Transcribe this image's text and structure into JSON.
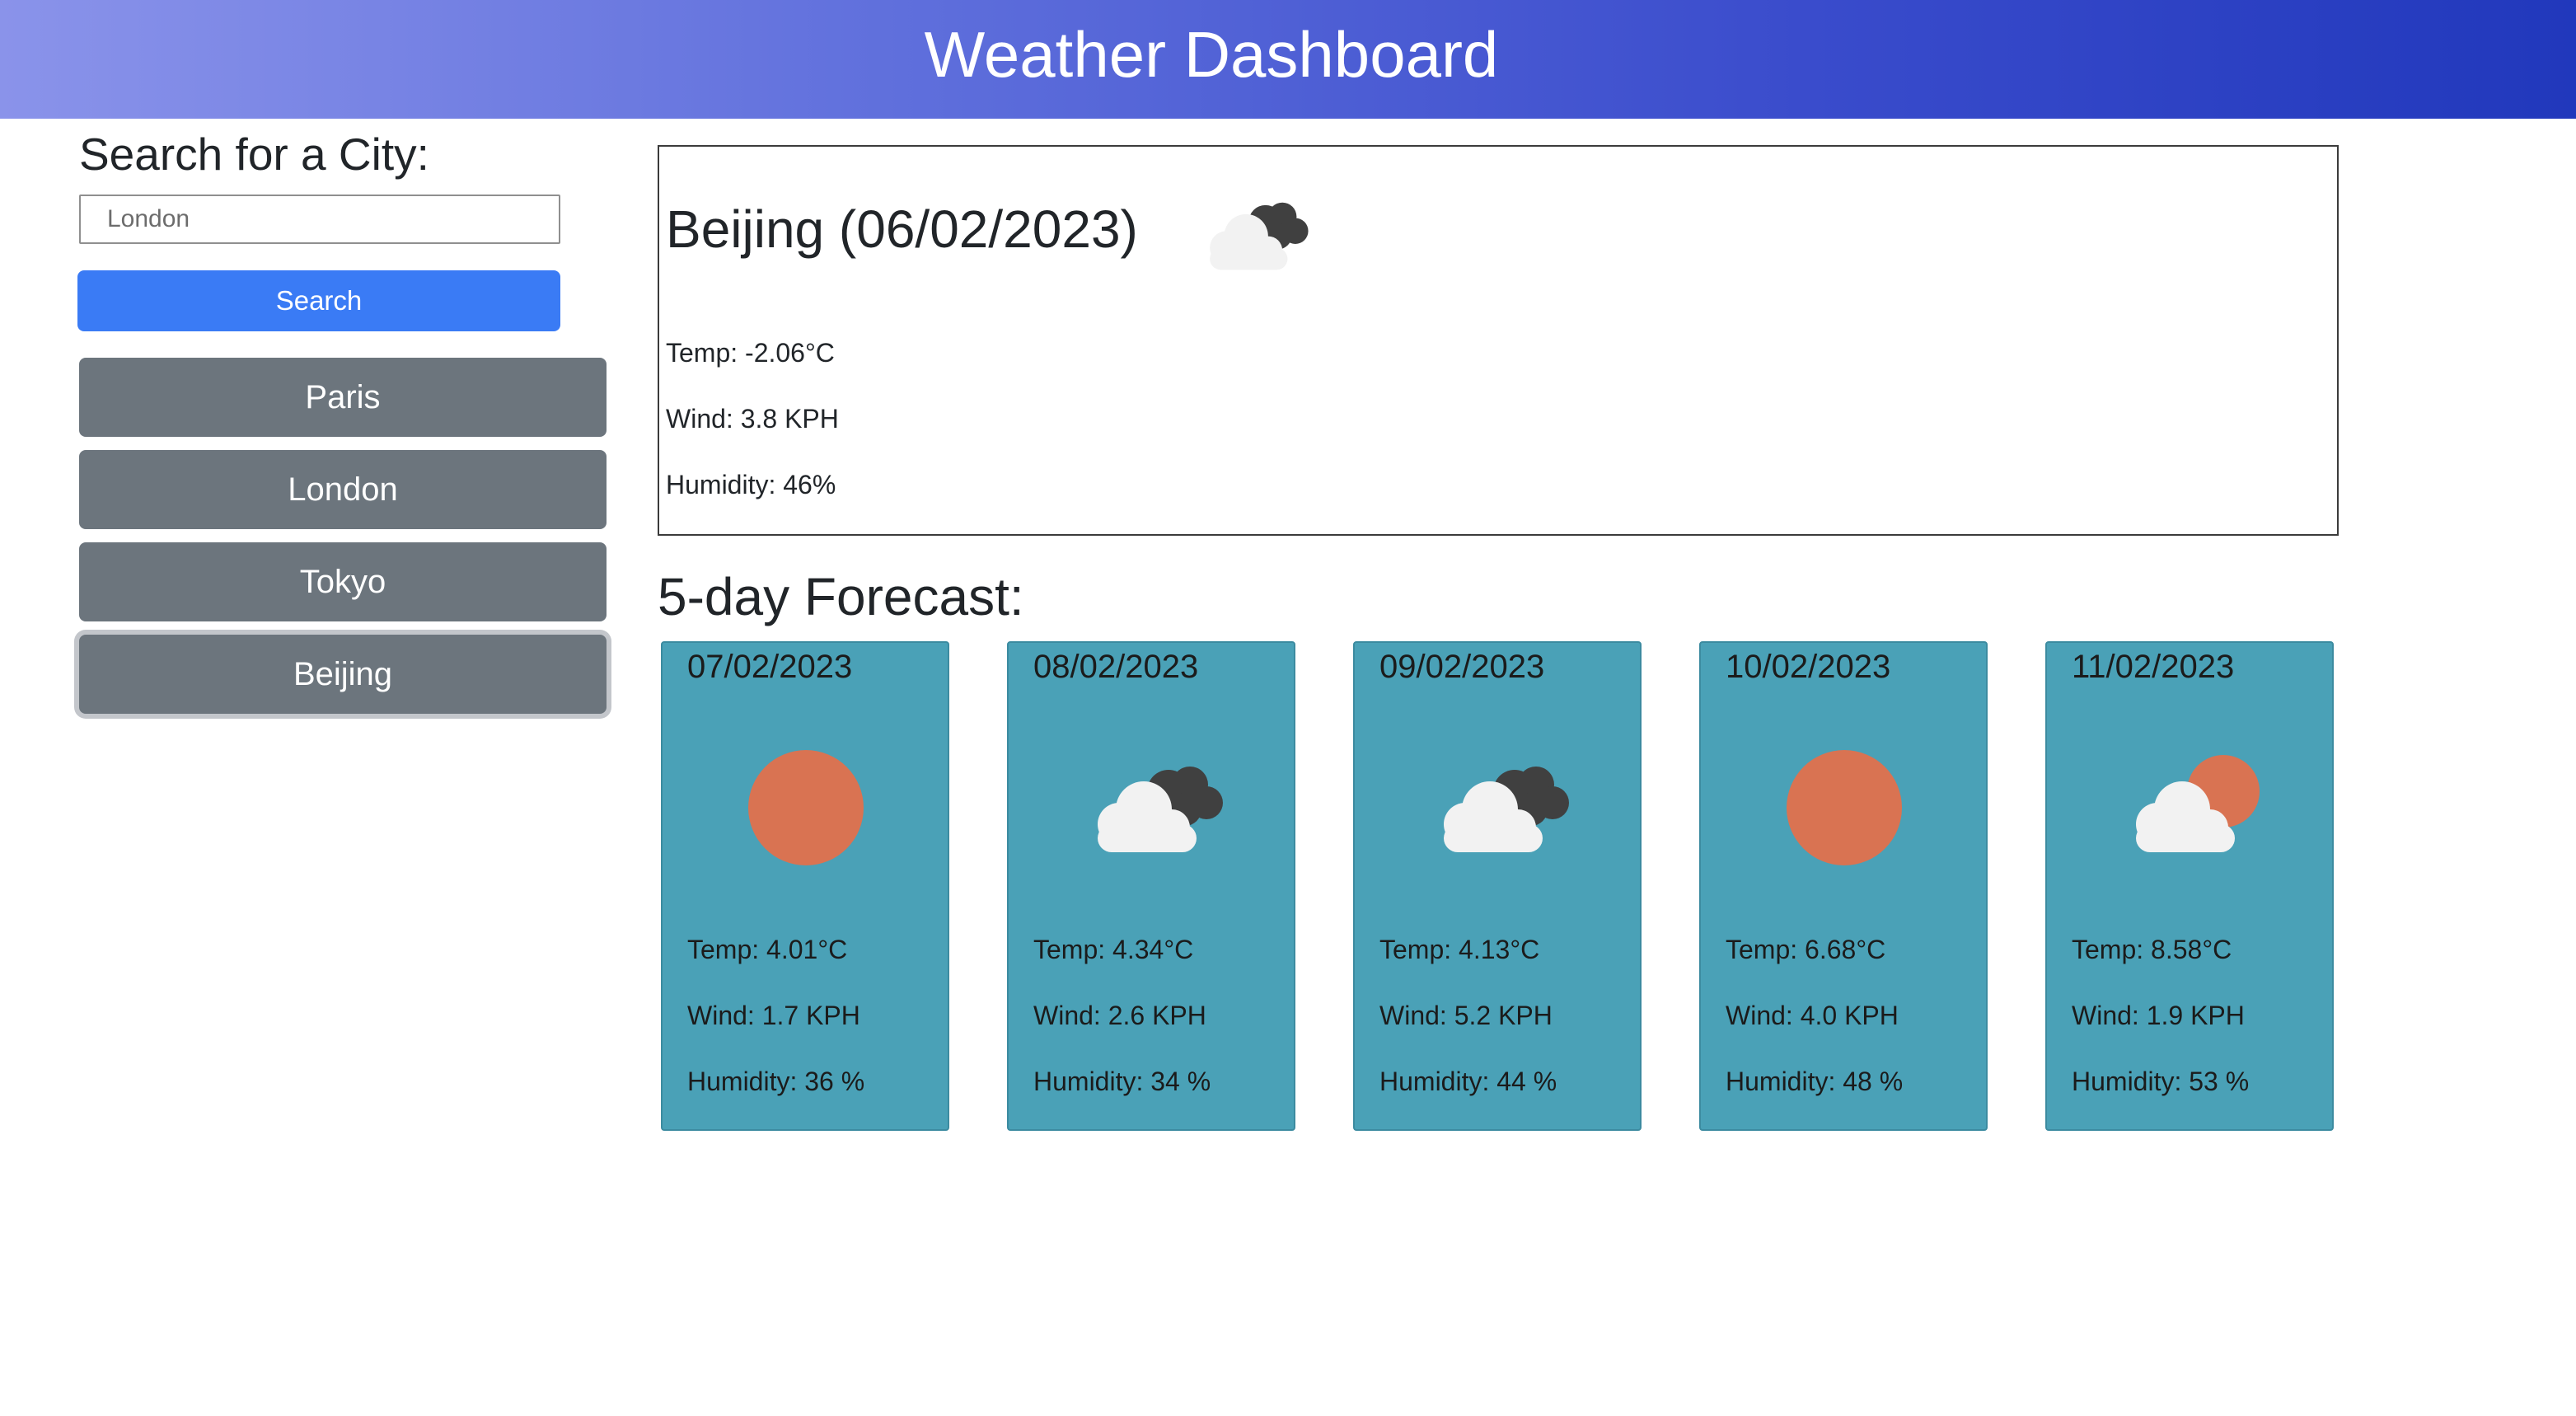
{
  "header": {
    "title": "Weather Dashboard"
  },
  "search": {
    "title": "Search for a City:",
    "input_value": "London",
    "placeholder": "",
    "button_label": "Search"
  },
  "history": [
    {
      "label": "Paris",
      "active": false
    },
    {
      "label": "London",
      "active": false
    },
    {
      "label": "Tokyo",
      "active": false
    },
    {
      "label": "Beijing",
      "active": true
    }
  ],
  "current": {
    "title": "Beijing (06/02/2023)",
    "icon": "cloudy-icon",
    "temp": "Temp: -2.06°C",
    "wind": "Wind: 3.8 KPH",
    "humidity": "Humidity: 46%"
  },
  "forecast": {
    "title": "5-day Forecast:",
    "days": [
      {
        "date": "07/02/2023",
        "icon": "sun-icon",
        "temp": "Temp: 4.01°C",
        "wind": "Wind: 1.7 KPH",
        "humidity": "Humidity: 36 %"
      },
      {
        "date": "08/02/2023",
        "icon": "cloudy-icon",
        "temp": "Temp: 4.34°C",
        "wind": "Wind: 2.6 KPH",
        "humidity": "Humidity: 34 %"
      },
      {
        "date": "09/02/2023",
        "icon": "cloudy-icon",
        "temp": "Temp: 4.13°C",
        "wind": "Wind: 5.2 KPH",
        "humidity": "Humidity: 44 %"
      },
      {
        "date": "10/02/2023",
        "icon": "sun-icon",
        "temp": "Temp: 6.68°C",
        "wind": "Wind: 4.0 KPH",
        "humidity": "Humidity: 48 %"
      },
      {
        "date": "11/02/2023",
        "icon": "partly-cloudy-icon",
        "temp": "Temp: 8.58°C",
        "wind": "Wind: 1.9 KPH",
        "humidity": "Humidity: 53 %"
      }
    ]
  },
  "colors": {
    "header_gradient_start": "#8a93ea",
    "header_gradient_end": "#2138bc",
    "search_button": "#3a7bf5",
    "history_button": "#6c757d",
    "forecast_card": "#4aa1b7",
    "sun": "#d97352",
    "dark_cloud": "#404040",
    "light_cloud": "#f2f2f2"
  }
}
